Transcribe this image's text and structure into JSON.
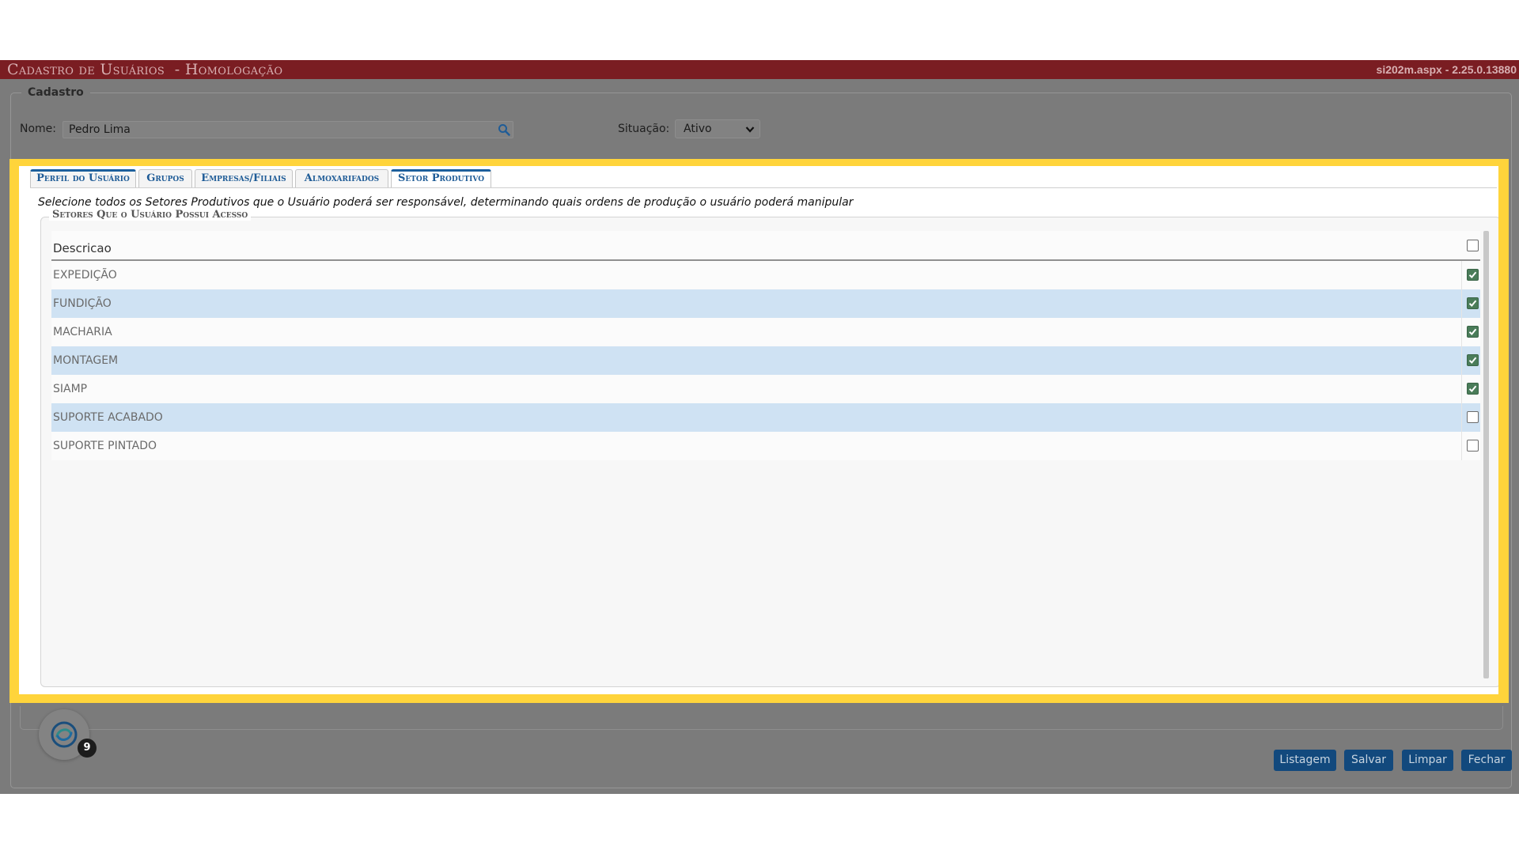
{
  "header": {
    "title": "Cadastro de Usuários  - Homologação",
    "version": "si202m.aspx - 2.25.0.13880"
  },
  "form": {
    "legend": "Cadastro",
    "nome_label": "Nome:",
    "nome_value": "Pedro Lima",
    "situacao_label": "Situação:",
    "situacao_value": "Ativo"
  },
  "tabs": [
    {
      "label": "Perfil do Usuário"
    },
    {
      "label": "Grupos"
    },
    {
      "label": "Empresas/Filiais"
    },
    {
      "label": "Almoxarifados"
    },
    {
      "label": "Setor Produtivo",
      "active": true
    }
  ],
  "setor": {
    "instruction": "Selecione todos os Setores Produtivos que o Usuário poderá ser responsável, determinando quais ordens de produção o usuário poderá manipular",
    "legend": "Setores Que o Usuário Possui Acesso",
    "column_header": "Descricao",
    "header_checked": false,
    "rows": [
      {
        "descricao": "EXPEDIÇÃO",
        "checked": true
      },
      {
        "descricao": "FUNDIÇÃO",
        "checked": true
      },
      {
        "descricao": "MACHARIA",
        "checked": true
      },
      {
        "descricao": "MONTAGEM",
        "checked": true
      },
      {
        "descricao": "SIAMP",
        "checked": true
      },
      {
        "descricao": "SUPORTE ACABADO",
        "checked": false
      },
      {
        "descricao": "SUPORTE PINTADO",
        "checked": false
      }
    ]
  },
  "notification_count": "9",
  "buttons": {
    "listagem": "Listagem",
    "salvar": "Salvar",
    "limpar": "Limpar",
    "fechar": "Fechar"
  },
  "colors": {
    "titlebar": "#7a1d22",
    "highlight": "#ffd43b",
    "tab_text": "#1f5c97",
    "alt_row": "#cfe2f3",
    "checkbox_on": "#4a7c59",
    "button": "#12497d"
  }
}
